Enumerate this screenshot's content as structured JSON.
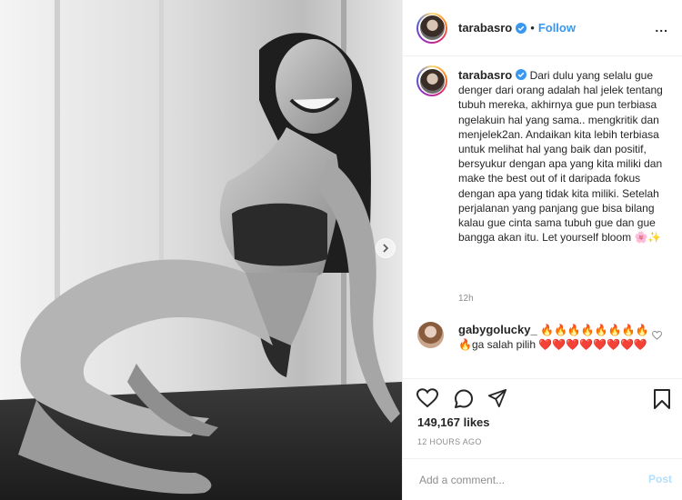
{
  "post": {
    "author": "tarabasro",
    "follow_label": "Follow",
    "separator": "•",
    "more_label": "...",
    "caption": "Dari dulu yang selalu gue denger dari orang adalah hal jelek tentang tubuh mereka, akhirnya gue pun terbiasa ngelakuin hal yang sama.. mengkritik dan menjelek2an. Andaikan kita lebih terbiasa untuk melihat hal yang baik dan positif, bersyukur dengan apa yang kita miliki dan make the best out of it daripada fokus dengan apa yang tidak kita miliki. Setelah perjalanan yang panjang gue bisa bilang kalau gue cinta sama tubuh gue dan gue bangga akan itu. Let yourself bloom 🌸✨",
    "caption_age": "12h",
    "likes": "149,167 likes",
    "timestamp": "12 HOURS AGO"
  },
  "comment": {
    "author": "gabygolucky_",
    "text": "🔥🔥🔥🔥🔥🔥🔥🔥🔥ga salah pilih ❤️❤️❤️❤️❤️❤️❤️❤️"
  },
  "add_comment": {
    "placeholder": "Add a comment...",
    "post_label": "Post"
  },
  "icons": {
    "verified": "verified-badge-icon",
    "like": "heart-icon",
    "comment": "comment-bubble-icon",
    "share": "paper-plane-icon",
    "save": "bookmark-icon",
    "next": "chevron-right-icon"
  },
  "colors": {
    "accent": "#3897f0",
    "text": "#262626",
    "muted": "#8e8e8e",
    "post_disabled": "#b2dffc"
  }
}
